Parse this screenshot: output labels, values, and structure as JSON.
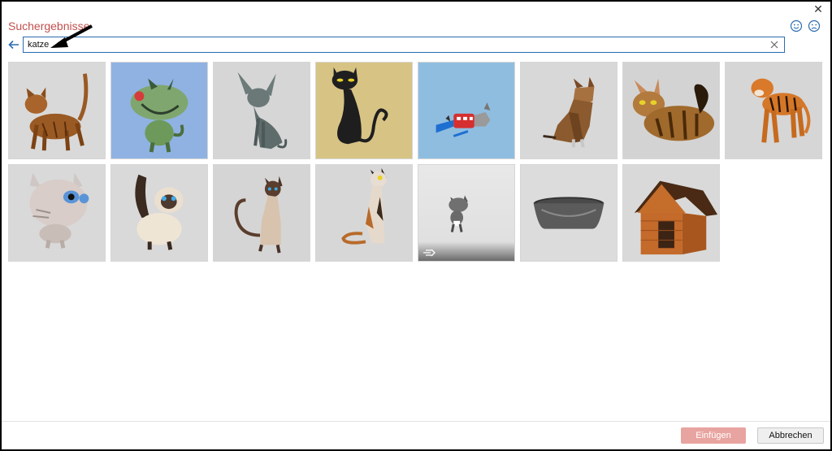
{
  "dialog": {
    "title": "Suchergebnisse",
    "close_icon": "close-icon",
    "feedback": [
      "smile-icon",
      "frown-icon"
    ]
  },
  "search": {
    "value": "katze",
    "back_icon": "back-arrow-icon",
    "clear_icon": "clear-icon"
  },
  "results": [
    {
      "name": "tabby-cat",
      "bg": "#d9d9d9"
    },
    {
      "name": "green-cartoon-cat",
      "bg": "#8fb2e3"
    },
    {
      "name": "sphynx-cat",
      "bg": "#d6d6d6"
    },
    {
      "name": "black-cartoon-cat",
      "bg": "#d7c384"
    },
    {
      "name": "flying-cat-toy",
      "bg": "#8fbde0"
    },
    {
      "name": "lowpoly-brown-cat",
      "bg": "#d8d8d8"
    },
    {
      "name": "maine-coon-cat",
      "bg": "#d3d3d3"
    },
    {
      "name": "tiger",
      "bg": "#d6d6d6"
    },
    {
      "name": "big-eyed-cat",
      "bg": "#d9d9d9"
    },
    {
      "name": "birman-cat",
      "bg": "#d9d9d9"
    },
    {
      "name": "siamese-cat",
      "bg": "#d5d5d5"
    },
    {
      "name": "calico-cat",
      "bg": "#d7d7d7"
    },
    {
      "name": "animated-grey-cat",
      "bg": "#e4e4e4",
      "animated": true
    },
    {
      "name": "metal-bowl",
      "bg": "#dcdcdc"
    },
    {
      "name": "wooden-doghouse",
      "bg": "#d9d9d9"
    }
  ],
  "footer": {
    "insert_label": "Einfügen",
    "cancel_label": "Abbrechen"
  },
  "colors": {
    "title": "#c0504d",
    "search_border": "#2b6cb0",
    "insert_bg": "#e8a4a0"
  }
}
